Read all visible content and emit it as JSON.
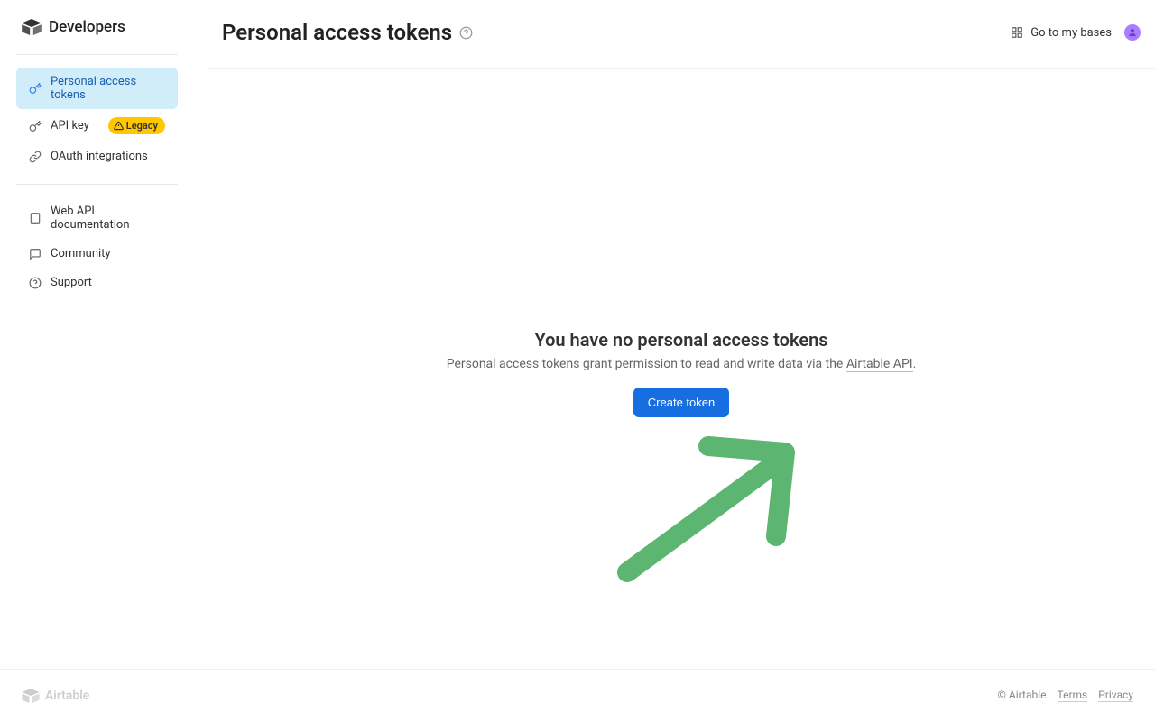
{
  "brand": {
    "name": "Developers",
    "footer_name": "Airtable"
  },
  "header": {
    "title": "Personal access tokens",
    "go_bases": "Go to my bases"
  },
  "sidebar": {
    "items": [
      {
        "label": "Personal access tokens"
      },
      {
        "label": "API key",
        "badge": "Legacy"
      },
      {
        "label": "OAuth integrations"
      }
    ],
    "resources": [
      {
        "label": "Web API documentation"
      },
      {
        "label": "Community"
      },
      {
        "label": "Support"
      }
    ]
  },
  "empty": {
    "title": "You have no personal access tokens",
    "desc_prefix": "Personal access tokens grant permission to read and write data via the ",
    "api_link": "Airtable API",
    "desc_suffix": ".",
    "cta": "Create token"
  },
  "footer": {
    "copyright": "© Airtable",
    "terms": "Terms",
    "privacy": "Privacy"
  }
}
